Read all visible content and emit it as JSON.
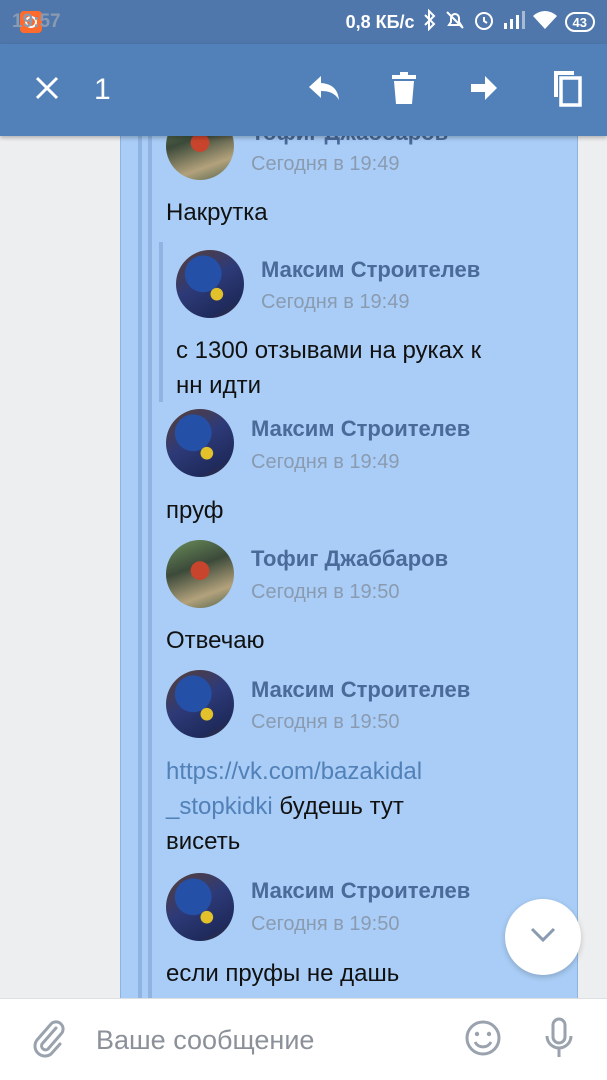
{
  "status": {
    "time": "19:57",
    "speed": "0,8 КБ/с",
    "battery": "43"
  },
  "actionbar": {
    "selected_count": "1"
  },
  "messages": [
    {
      "name": "Тофиг Джаббаров",
      "time": "Сегодня в 19:49",
      "text": "Накрутка"
    },
    {
      "name": "Максим Строителев",
      "time": "Сегодня в 19:49",
      "text_line1": "с 1300 отзывами на руках к",
      "text_line2": "нн идти"
    },
    {
      "name": "Максим Строителев",
      "time": "Сегодня в 19:49",
      "text": "пруф"
    },
    {
      "name": "Тофиг Джаббаров",
      "time": "Сегодня в 19:50",
      "text": "Отвечаю"
    },
    {
      "name": "Максим Строителев",
      "time": "Сегодня в 19:50",
      "link_line1": "https://vk.com/bazakidal",
      "link_line2": "_stopkidki",
      "text_after_link": " будешь тут",
      "text_line3": "висеть"
    },
    {
      "name": "Максим Строителев",
      "time": "Сегодня в 19:50",
      "text": "если пруфы не дашь"
    }
  ],
  "composer": {
    "placeholder": "Ваше сообщение"
  },
  "icons": [
    "close-icon",
    "reply-icon",
    "trash-icon",
    "forward-icon",
    "copy-icon",
    "chevron-down-icon",
    "attach-icon",
    "smile-icon",
    "mic-icon"
  ],
  "colors": {
    "accent": "#5181b8",
    "selection": "#a9cdf6",
    "name": "#4a6a99"
  }
}
